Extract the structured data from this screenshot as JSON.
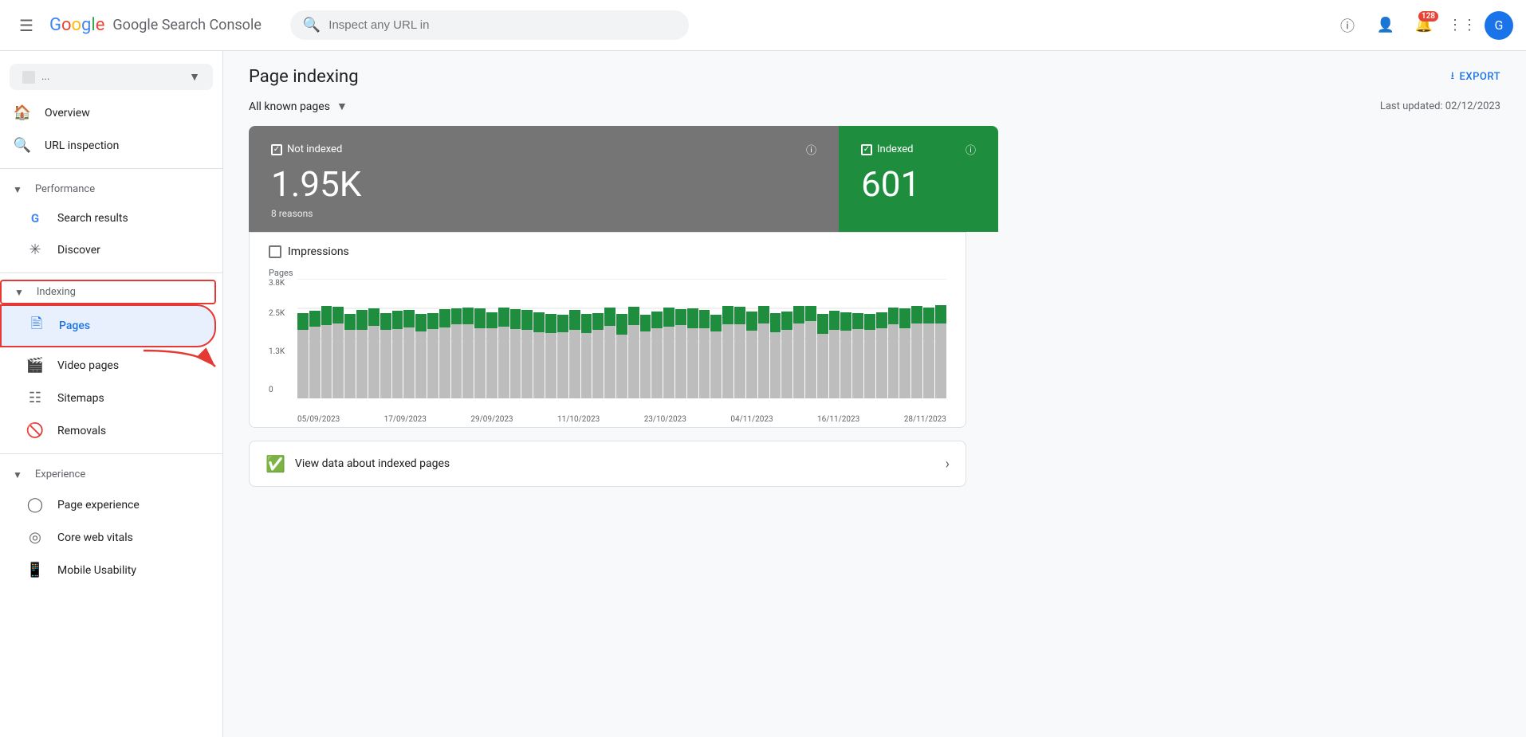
{
  "app": {
    "title": "Google Search Console",
    "logo_parts": [
      "G",
      "o",
      "o",
      "g",
      "l",
      "e"
    ],
    "search_placeholder": "Inspect any URL in"
  },
  "topbar": {
    "notification_count": "128",
    "avatar_letter": "G"
  },
  "sidebar": {
    "property_label": "...",
    "items": [
      {
        "id": "overview",
        "label": "Overview",
        "icon": "🏠",
        "active": false
      },
      {
        "id": "url-inspection",
        "label": "URL inspection",
        "icon": "🔍",
        "active": false
      },
      {
        "id": "performance-header",
        "label": "Performance",
        "section": true
      },
      {
        "id": "search-results",
        "label": "Search results",
        "icon": "G",
        "active": false,
        "indent": true
      },
      {
        "id": "discover",
        "label": "Discover",
        "icon": "✳",
        "active": false,
        "indent": true
      },
      {
        "id": "indexing-header",
        "label": "Indexing",
        "section": true
      },
      {
        "id": "pages",
        "label": "Pages",
        "icon": "📄",
        "active": true,
        "indent": true
      },
      {
        "id": "video-pages",
        "label": "Video pages",
        "icon": "🎬",
        "active": false,
        "indent": true
      },
      {
        "id": "sitemaps",
        "label": "Sitemaps",
        "icon": "⊞",
        "active": false,
        "indent": true
      },
      {
        "id": "removals",
        "label": "Removals",
        "icon": "🚫",
        "active": false,
        "indent": true
      },
      {
        "id": "experience-header",
        "label": "Experience",
        "section": true
      },
      {
        "id": "page-experience",
        "label": "Page experience",
        "icon": "⊙",
        "active": false,
        "indent": true
      },
      {
        "id": "core-web-vitals",
        "label": "Core web vitals",
        "icon": "◎",
        "active": false,
        "indent": true
      },
      {
        "id": "mobile-usability",
        "label": "Mobile Usability",
        "icon": "📱",
        "active": false,
        "indent": true
      }
    ]
  },
  "main": {
    "page_title": "Page indexing",
    "export_label": "EXPORT",
    "filter": {
      "label": "All known pages",
      "last_updated": "Last updated: 02/12/2023"
    },
    "stats": {
      "not_indexed": {
        "label": "Not indexed",
        "value": "1.95K",
        "sub": "8 reasons"
      },
      "indexed": {
        "label": "Indexed",
        "value": "601"
      }
    },
    "chart": {
      "impressions_label": "Impressions",
      "y_label": "Pages",
      "y_ticks": [
        "3.8K",
        "2.5K",
        "1.3K",
        "0"
      ],
      "x_labels": [
        "05/09/2023",
        "17/09/2023",
        "29/09/2023",
        "11/10/2023",
        "23/10/2023",
        "04/11/2023",
        "16/11/2023",
        "28/11/2023"
      ]
    },
    "view_data": {
      "text": "View data about indexed pages"
    }
  }
}
